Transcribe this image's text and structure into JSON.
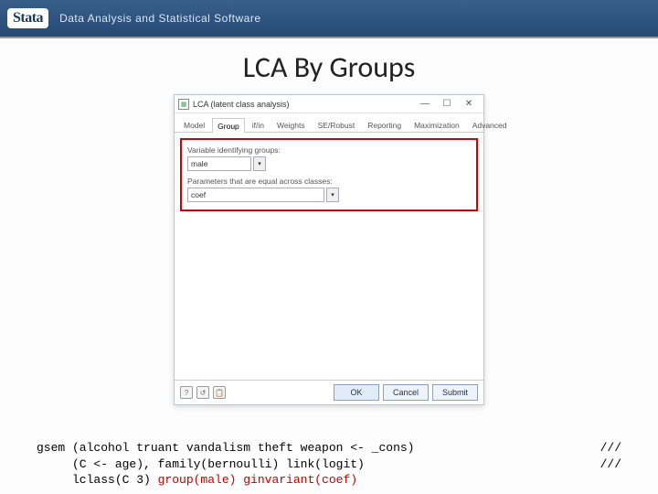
{
  "topbar": {
    "logo": "Stata",
    "tagline": "Data Analysis and Statistical Software"
  },
  "slide": {
    "title": "LCA By Groups"
  },
  "dialog": {
    "title": "LCA (latent class analysis)",
    "tabs": [
      "Model",
      "Group",
      "if/in",
      "Weights",
      "SE/Robust",
      "Reporting",
      "Maximization",
      "Advanced"
    ],
    "active_tab": "Group",
    "label_var": "Variable identifying groups:",
    "field_var": "male",
    "label_param": "Parameters that are equal across classes:",
    "field_param": "coef",
    "buttons": {
      "ok": "OK",
      "cancel": "Cancel",
      "submit": "Submit"
    }
  },
  "code": {
    "l1": "gsem (alcohol truant vandalism theft weapon <- _cons)",
    "l2": "     (C <- age), family(bernoulli) link(logit)",
    "l3a": "     lclass(C 3) ",
    "l3b": "group(male) ginvariant(coef)",
    "cont1": "///",
    "cont2": "///"
  }
}
